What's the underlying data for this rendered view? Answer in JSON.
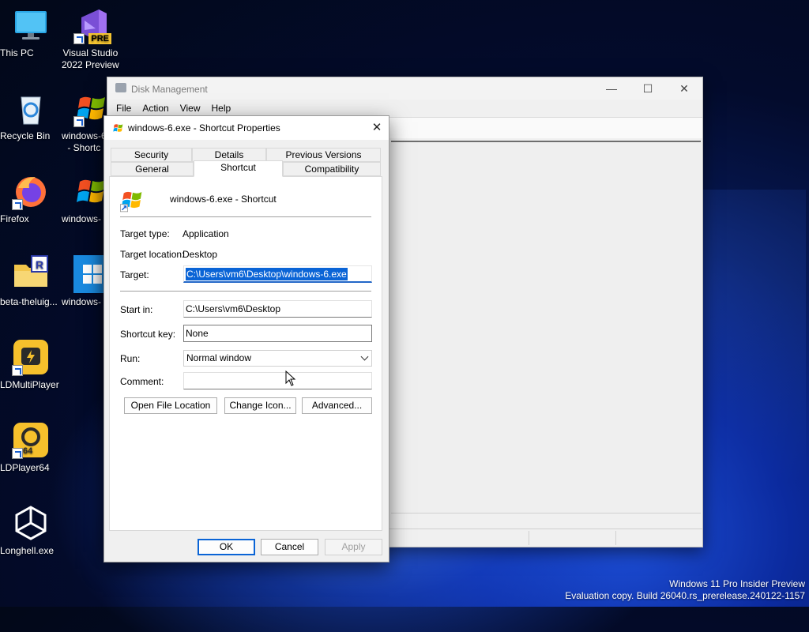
{
  "desktop": {
    "icons": [
      {
        "label": "This PC",
        "icon": "monitor-icon"
      },
      {
        "label": "Visual Studio\n2022 Preview",
        "icon": "visual-studio-icon",
        "badge": "PRE"
      },
      {
        "label": "Recycle Bin",
        "icon": "recycle-bin-icon"
      },
      {
        "label": "windows-6\n- Shortc",
        "icon": "windows-flag-icon"
      },
      {
        "label": "Firefox",
        "icon": "firefox-icon"
      },
      {
        "label": "windows-",
        "icon": "windows-flag-icon"
      },
      {
        "label": "beta-theluig...",
        "icon": "folder-icon",
        "badge": "R"
      },
      {
        "label": "windows-",
        "icon": "windows-11-icon"
      },
      {
        "label": "LDMultiPlayer",
        "icon": "ldmultiplayer-icon"
      },
      {
        "label": "LDPlayer64",
        "icon": "ldplayer-icon",
        "badge": "64"
      },
      {
        "label": "Longhell.exe",
        "icon": "unity-icon"
      }
    ]
  },
  "disk_management": {
    "title": "Disk Management",
    "menu": [
      "File",
      "Action",
      "View",
      "Help"
    ]
  },
  "dialog": {
    "title": "windows-6.exe - Shortcut Properties",
    "tabs_row1": [
      "Security",
      "Details",
      "Previous Versions"
    ],
    "tabs_row2": [
      "General",
      "Shortcut",
      "Compatibility"
    ],
    "active_tab": "Shortcut",
    "shortcut_name": "windows-6.exe - Shortcut",
    "target_type_label": "Target type:",
    "target_type_value": "Application",
    "target_location_label": "Target location:",
    "target_location_value": "Desktop",
    "target_label": "Target:",
    "target_value": "C:\\Users\\vm6\\Desktop\\windows-6.exe",
    "start_in_label": "Start in:",
    "start_in_value": "C:\\Users\\vm6\\Desktop",
    "shortcut_key_label": "Shortcut key:",
    "shortcut_key_value": "None",
    "run_label": "Run:",
    "run_value": "Normal window",
    "comment_label": "Comment:",
    "comment_value": "",
    "buttons": {
      "open_file_location": "Open File Location",
      "change_icon": "Change Icon...",
      "advanced": "Advanced...",
      "ok": "OK",
      "cancel": "Cancel",
      "apply": "Apply"
    }
  },
  "watermark": {
    "line1": "Windows 11 Pro Insider Preview",
    "line2": "Evaluation copy. Build 26040.rs_prerelease.240122-1157"
  },
  "colors": {
    "accent": "#0a64d6",
    "desktop_bg": "#071a5a"
  }
}
